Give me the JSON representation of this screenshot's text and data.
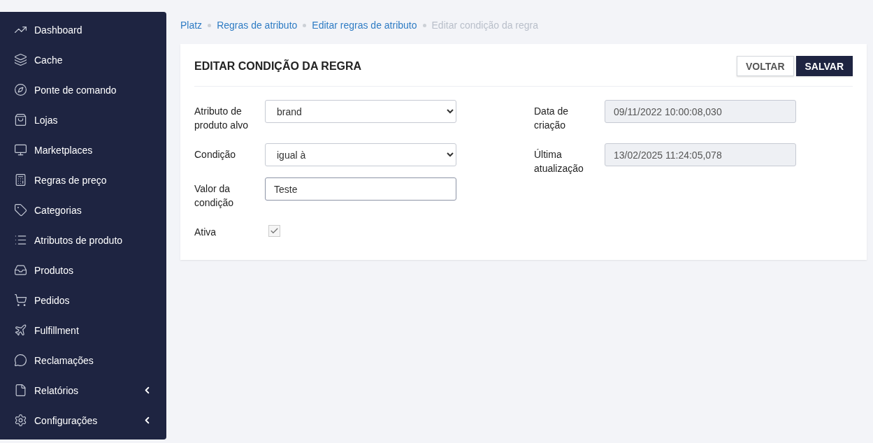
{
  "sidebar": {
    "items": [
      {
        "label": "Dashboard"
      },
      {
        "label": "Cache"
      },
      {
        "label": "Ponte de comando"
      },
      {
        "label": "Lojas"
      },
      {
        "label": "Marketplaces"
      },
      {
        "label": "Regras de preço"
      },
      {
        "label": "Categorias"
      },
      {
        "label": "Atributos de produto"
      },
      {
        "label": "Produtos"
      },
      {
        "label": "Pedidos"
      },
      {
        "label": "Fulfillment"
      },
      {
        "label": "Reclamações"
      },
      {
        "label": "Relatórios",
        "expanded": false
      },
      {
        "label": "Configurações",
        "expanded": false
      }
    ]
  },
  "breadcrumbs": [
    {
      "label": "Platz",
      "current": false
    },
    {
      "label": "Regras de atributo",
      "current": false
    },
    {
      "label": "Editar regras de atributo",
      "current": false
    },
    {
      "label": "Editar condição da regra",
      "current": true
    }
  ],
  "card": {
    "title": "EDITAR CONDIÇÃO DA REGRA",
    "buttons": [
      {
        "label": "VOLTAR",
        "kind": "secondary"
      },
      {
        "label": "SALVAR",
        "kind": "primary"
      }
    ],
    "left_fields": [
      {
        "kind": "select",
        "label": "Atributo de produto alvo",
        "value": "brand"
      },
      {
        "kind": "select",
        "label": "Condição",
        "value": "igual à"
      },
      {
        "kind": "text",
        "label": "Valor da condição",
        "value": "Teste"
      },
      {
        "kind": "checkbox",
        "label": "Ativa",
        "checked": true
      }
    ],
    "right_fields": [
      {
        "kind": "readonly",
        "label": "Data de criação",
        "value": "09/11/2022 10:00:08,030"
      },
      {
        "kind": "readonly",
        "label": "Última atualização",
        "value": "13/02/2025 11:24:05,078"
      }
    ]
  }
}
